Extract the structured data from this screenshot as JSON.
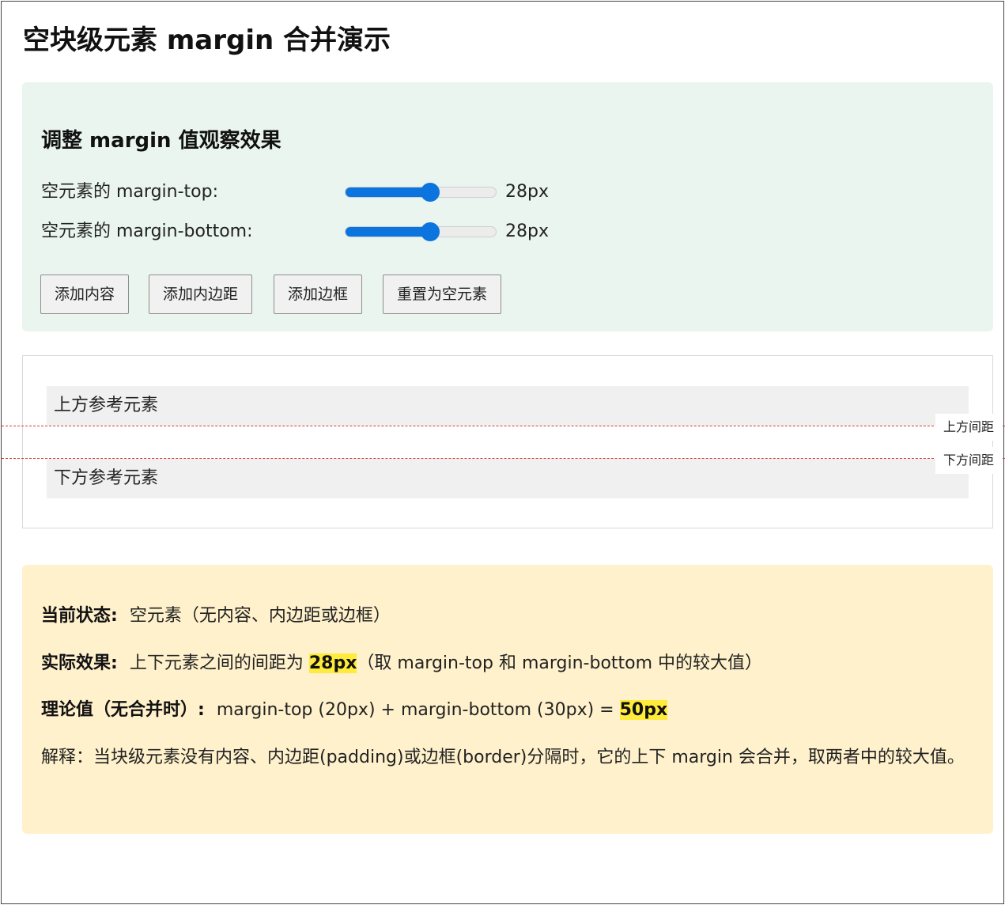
{
  "page": {
    "title": "空块级元素 margin 合并演示"
  },
  "controls": {
    "title": "调整 margin 值观察效果",
    "margin_top": {
      "label": "空元素的 margin-top:",
      "value": "28px",
      "fraction": 0.56
    },
    "margin_bottom": {
      "label": "空元素的 margin-bottom:",
      "value": "28px",
      "fraction": 0.56
    },
    "buttons": {
      "add_content": "添加内容",
      "add_padding": "添加内边距",
      "add_border": "添加边框",
      "reset": "重置为空元素"
    }
  },
  "demo": {
    "top_block": "上方参考元素",
    "bottom_block": "下方参考元素",
    "top_gap_label": "上方间距",
    "bottom_gap_label": "下方间距",
    "guide_color": "#d83b3b"
  },
  "info": {
    "state_key": "当前状态:",
    "state_value": "空元素（无内容、内边距或边框）",
    "effect_key": "实际效果:",
    "effect_prefix": "上下元素之间的间距为",
    "effect_value": "28px",
    "effect_suffix": "（取 margin-top 和 margin-bottom 中的较大值）",
    "theory_key": "理论值（无合并时）:",
    "theory_prefix": "margin-top (20px) + margin-bottom (30px) =",
    "theory_value": "50px",
    "explanation": "解释：当块级元素没有内容、内边距(padding)或边框(border)分隔时，它的上下 margin 会合并，取两者中的较大值。"
  },
  "colors": {
    "accent": "#0b74de",
    "control_bg": "#e9f5ee",
    "info_bg": "#fff1cc",
    "highlight": "#ffeb3b"
  }
}
